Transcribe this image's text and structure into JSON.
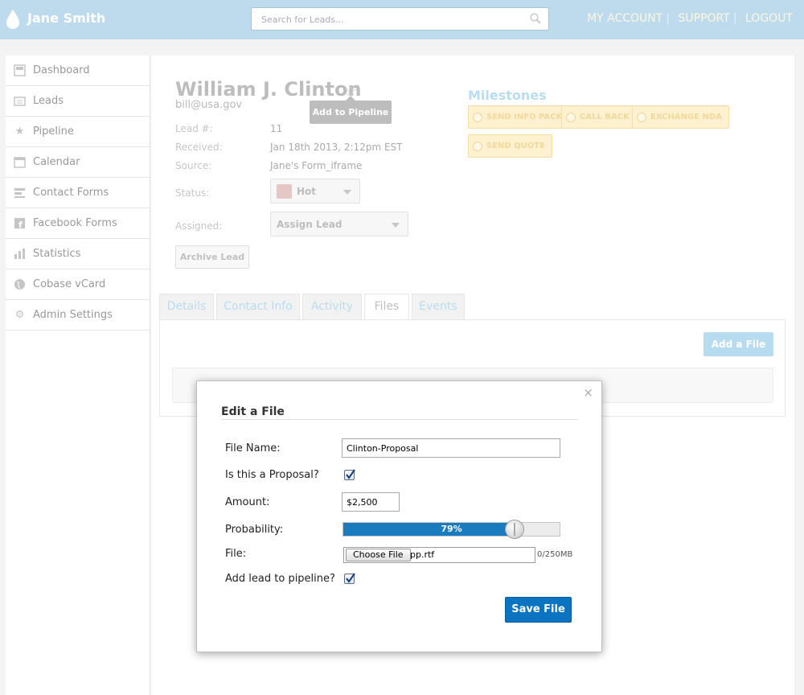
{
  "header": {
    "brand": "Jane Smith",
    "search_placeholder": "Search for Leads...",
    "links": [
      "MY ACCOUNT",
      "SUPPORT",
      "LOGOUT"
    ]
  },
  "sidebar": {
    "items": [
      {
        "label": "Dashboard",
        "icon": "dashboard-icon"
      },
      {
        "label": "Leads",
        "icon": "leads-icon"
      },
      {
        "label": "Pipeline",
        "icon": "star-icon"
      },
      {
        "label": "Calendar",
        "icon": "calendar-icon"
      },
      {
        "label": "Contact Forms",
        "icon": "forms-icon"
      },
      {
        "label": "Facebook Forms",
        "icon": "facebook-icon"
      },
      {
        "label": "Statistics",
        "icon": "bar-chart-icon"
      },
      {
        "label": "Cobase vCard",
        "icon": "globe-icon"
      },
      {
        "label": "Admin Settings",
        "icon": "gear-icon"
      }
    ]
  },
  "lead": {
    "name": "William J. Clinton",
    "email": "bill@usa.gov",
    "tooltip": "Add to Pipeline",
    "fields": {
      "lead_num_label": "Lead #:",
      "lead_num": "11",
      "received_label": "Received:",
      "received": "Jan 18th 2013, 2:12pm EST",
      "source_label": "Source:",
      "source": "Jane's Form_iframe",
      "status_label": "Status:",
      "status": "Hot",
      "status_color": "#e6c7c7",
      "assigned_label": "Assigned:",
      "assigned": "Assign Lead"
    },
    "archive_label": "Archive Lead"
  },
  "milestones": {
    "title": "Milestones",
    "items": [
      "SEND INFO PACK",
      "CALL BACK",
      "EXCHANGE NDA",
      "SEND QUOTE"
    ]
  },
  "tabs": [
    "Details",
    "Contact Info",
    "Activity",
    "Files",
    "Events"
  ],
  "active_tab": "Files",
  "files_panel": {
    "add_file_label": "Add a File"
  },
  "modal": {
    "close": "×",
    "title": "Edit a File",
    "file_name_label": "File Name:",
    "file_name_value": "Clinton-Proposal",
    "is_proposal_label": "Is this a Proposal?",
    "is_proposal_checked": true,
    "amount_label": "Amount:",
    "amount_value": "$2,500",
    "probability_label": "Probability:",
    "probability_value": 79,
    "probability_text": "79%",
    "file_label": "File:",
    "choose_file_label": "Choose File",
    "chosen_file": "pp.rtf",
    "file_size": "0/250MB",
    "add_pipeline_label": "Add lead to pipeline?",
    "add_pipeline_checked": true,
    "save_label": "Save File"
  },
  "colors": {
    "header_bg": "#bddbec",
    "accent_blue": "#0a74c0",
    "milestone_bg": "#fdf1cf"
  }
}
